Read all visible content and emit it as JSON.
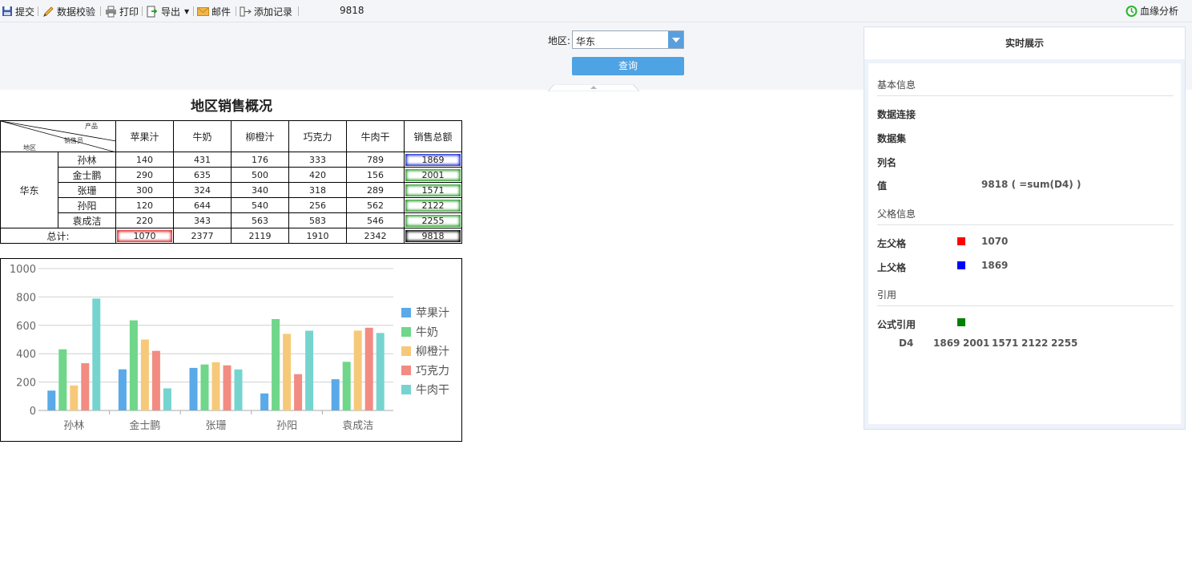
{
  "toolbar": {
    "submit": "提交",
    "validate": "数据校验",
    "print": "打印",
    "export": "导出",
    "mail": "邮件",
    "add_record": "添加记录",
    "current_value": "9818",
    "lineage": "血缘分析"
  },
  "params": {
    "region_label": "地区:",
    "region_value": "华东",
    "query_label": "查询"
  },
  "report": {
    "title": "地区销售概况",
    "corner": {
      "top": "产品",
      "middle": "销售员",
      "bottom": "地区"
    },
    "columns": [
      "苹果汁",
      "牛奶",
      "柳橙汁",
      "巧克力",
      "牛肉干",
      "销售总额"
    ],
    "region": "华东",
    "rows": [
      {
        "name": "孙林",
        "values": [
          "140",
          "431",
          "176",
          "333",
          "789"
        ],
        "total": "1869"
      },
      {
        "name": "金士鹏",
        "values": [
          "290",
          "635",
          "500",
          "420",
          "156"
        ],
        "total": "2001"
      },
      {
        "name": "张珊",
        "values": [
          "300",
          "324",
          "340",
          "318",
          "289"
        ],
        "total": "1571"
      },
      {
        "name": "孙阳",
        "values": [
          "120",
          "644",
          "540",
          "256",
          "562"
        ],
        "total": "2122"
      },
      {
        "name": "袁成洁",
        "values": [
          "220",
          "343",
          "563",
          "583",
          "546"
        ],
        "total": "2255"
      }
    ],
    "total_label": "总计:",
    "totals": [
      "1070",
      "2377",
      "2119",
      "1910",
      "2342",
      "9818"
    ]
  },
  "chart_data": {
    "type": "bar",
    "categories": [
      "孙林",
      "金士鹏",
      "张珊",
      "孙阳",
      "袁成洁"
    ],
    "series": [
      {
        "name": "苹果汁",
        "color": "#5aa9e8",
        "values": [
          140,
          290,
          300,
          120,
          220
        ]
      },
      {
        "name": "牛奶",
        "color": "#6fd68a",
        "values": [
          431,
          635,
          324,
          644,
          343
        ]
      },
      {
        "name": "柳橙汁",
        "color": "#f6c97a",
        "values": [
          176,
          500,
          340,
          540,
          563
        ]
      },
      {
        "name": "巧克力",
        "color": "#f28b82",
        "values": [
          333,
          420,
          318,
          256,
          583
        ]
      },
      {
        "name": "牛肉干",
        "color": "#76d4cf",
        "values": [
          789,
          156,
          289,
          562,
          546
        ]
      }
    ],
    "ylim": [
      0,
      1000
    ],
    "yticks": [
      "0",
      "200",
      "400",
      "600",
      "800",
      "1000"
    ],
    "grid": true,
    "legend": "right"
  },
  "side": {
    "title": "实时展示",
    "basic_title": "基本信息",
    "data_connection_label": "数据连接",
    "dataset_label": "数据集",
    "column_label": "列名",
    "value_label": "值",
    "value": "9818 ( =sum(D4) )",
    "parent_title": "父格信息",
    "left_parent_label": "左父格",
    "left_parent_value": "1070",
    "left_parent_color": "#ff0000",
    "top_parent_label": "上父格",
    "top_parent_value": "1869",
    "top_parent_color": "#0000ff",
    "ref_title": "引用",
    "formula_ref_label": "公式引用",
    "formula_ref_color": "#008000",
    "ref_cell": "D4",
    "ref_values": [
      "1869",
      "2001",
      "1571",
      "2122",
      "2255"
    ]
  }
}
